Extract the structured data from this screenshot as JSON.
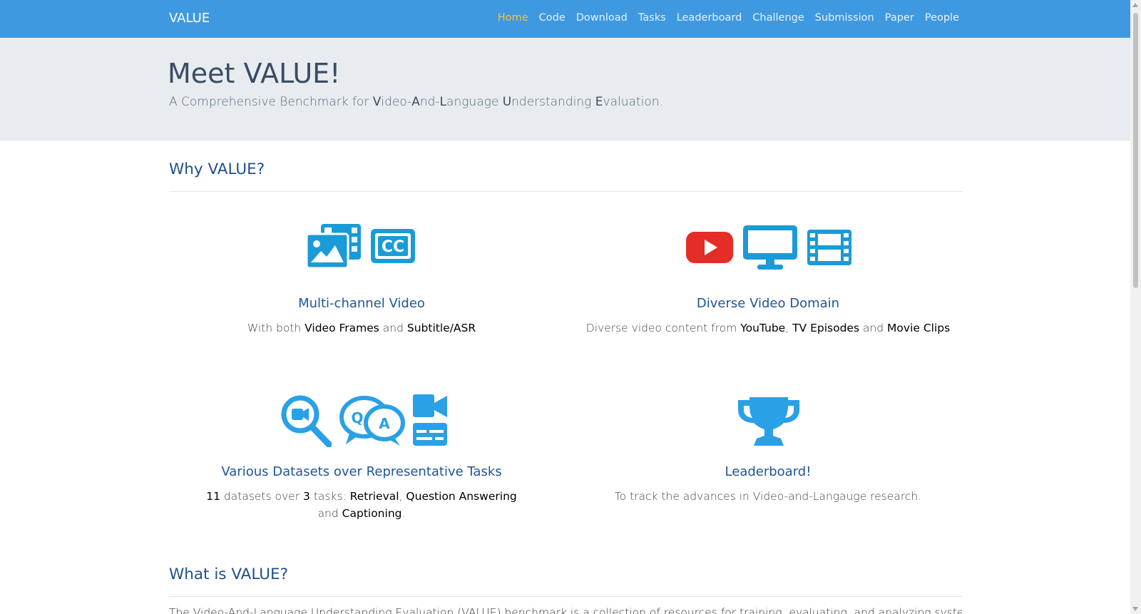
{
  "navbar": {
    "brand": "VALUE",
    "links": [
      "Home",
      "Code",
      "Download",
      "Tasks",
      "Leaderboard",
      "Challenge",
      "Submission",
      "Paper",
      "People"
    ],
    "active": "Home"
  },
  "jumbotron": {
    "title": "Meet VALUE!",
    "subtitle_parts": [
      "A Comprehensive Benchmark for ",
      "V",
      "ideo-",
      "A",
      "nd-",
      "L",
      "anguage ",
      "U",
      "nderstanding ",
      "E",
      "valuation."
    ]
  },
  "why": {
    "title": "Why VALUE?",
    "features": [
      {
        "title": "Multi-channel Video",
        "desc_parts": [
          "With both ",
          "Video Frames",
          " and ",
          "Subtitle/ASR"
        ],
        "icons": [
          "images-icon",
          "closed-captioning-icon"
        ]
      },
      {
        "title": "Diverse Video Domain",
        "desc_parts": [
          "Diverse video content from ",
          "YouTube",
          ", ",
          "TV Episodes",
          " and ",
          "Movie Clips"
        ],
        "icons": [
          "youtube-icon",
          "desktop-icon",
          "film-icon"
        ]
      },
      {
        "title": "Various Datasets over Representative Tasks",
        "desc_parts": [
          "11",
          " datasets over ",
          "3",
          " tasks: ",
          "Retrieval",
          ", ",
          "Question Answering",
          " and ",
          "Captioning",
          "."
        ],
        "icons": [
          "search-video-icon",
          "question-answer-icon",
          "video-caption-icon"
        ]
      },
      {
        "title": "Leaderboard!",
        "desc_parts": [
          "To track the advances in Video-and-Langauge research."
        ],
        "icons": [
          "trophy-icon"
        ]
      }
    ]
  },
  "what": {
    "title": "What is VALUE?",
    "text": "The Video-And-Language Understanding Evaluation (VALUE) benchmark is a collection of resources for training, evaluating, and analyzing systems for understanding"
  },
  "colors": {
    "navbar": "#3f99e0",
    "active_link": "#f5c040",
    "icon_blue": "#1a9bd7",
    "youtube_red": "#e52d27",
    "heading_blue": "#1f4f8a"
  }
}
